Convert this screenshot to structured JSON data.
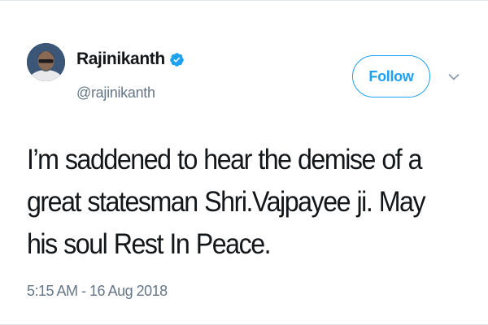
{
  "tweet": {
    "author": {
      "display_name": "Rajinikanth",
      "handle": "@rajinikanth",
      "verified": true,
      "avatar_icon": "profile-photo"
    },
    "follow_label": "Follow",
    "menu_icon": "chevron-down-icon",
    "text": "I’m saddened to hear the demise of a great statesman Shri.Vajpayee ji. May his soul Rest In Peace.",
    "timestamp": "5:15 AM - 16 Aug 2018"
  },
  "colors": {
    "accent": "#1da1f2",
    "text_primary": "#14171a",
    "text_secondary": "#657786",
    "background": "#ffffff"
  }
}
